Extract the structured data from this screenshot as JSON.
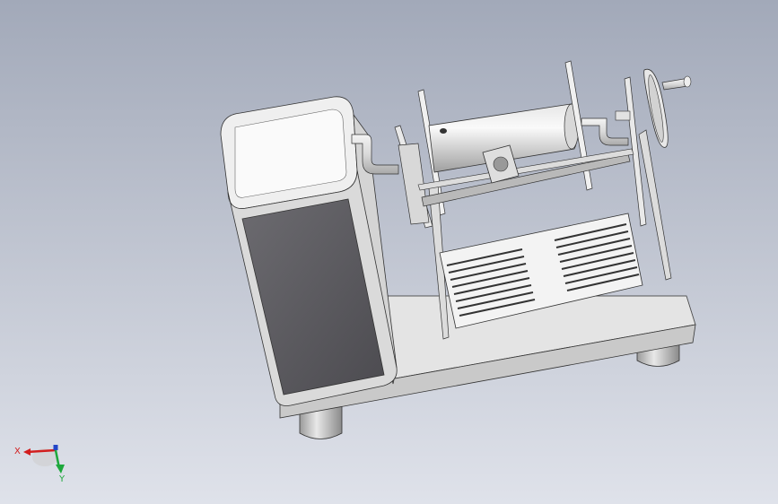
{
  "viewport": {
    "background_top": "#a2a9b9",
    "background_bottom": "#dfe2ea"
  },
  "model": {
    "parts": [
      "base-plate",
      "enclosure",
      "pipe-left",
      "spool-flange-left",
      "cylinder-drum",
      "spool-flange-right",
      "pipe-right",
      "handwheel",
      "crank-handle",
      "lead-screw",
      "slider-block",
      "vent-grille",
      "feet"
    ]
  },
  "triad": {
    "x_label": "X",
    "y_label": "Y",
    "x_color": "#d21e1e",
    "y_color": "#1ea83c",
    "z_color": "#2346c8"
  }
}
